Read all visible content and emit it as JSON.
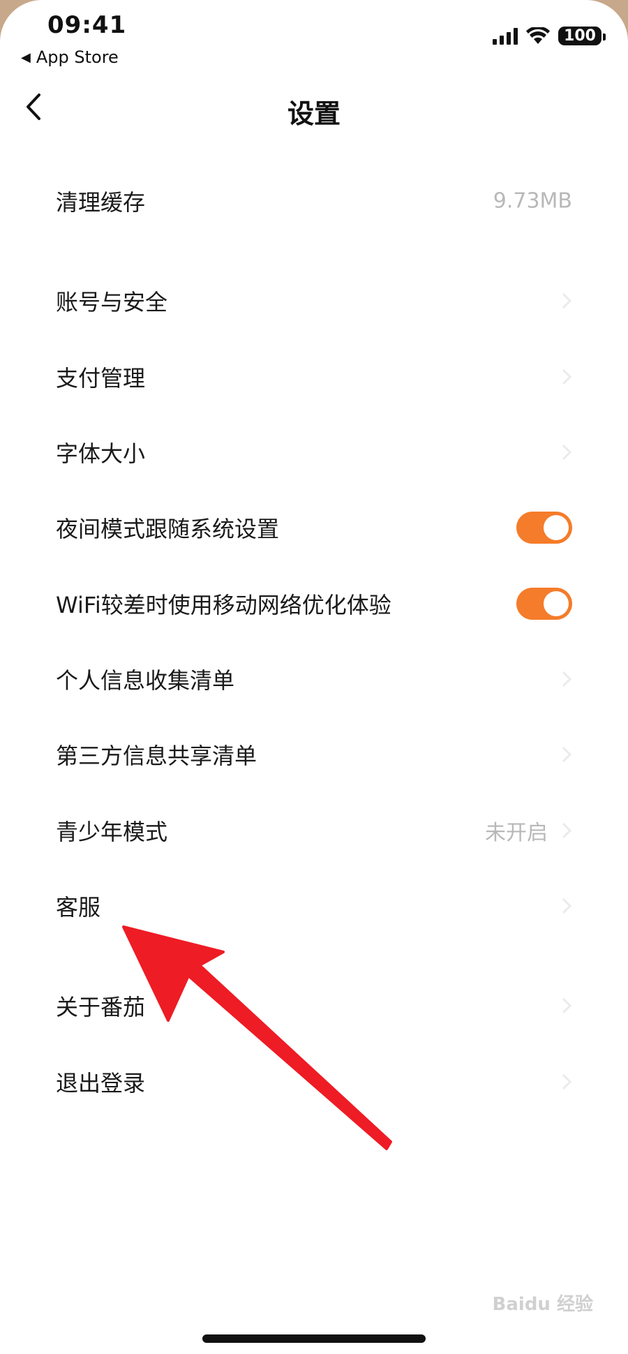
{
  "status_bar": {
    "time": "09:41",
    "back_app": "App Store",
    "battery": "100"
  },
  "nav": {
    "title": "设置"
  },
  "settings": {
    "clear_cache": {
      "label": "清理缓存",
      "value": "9.73MB"
    },
    "account_security": {
      "label": "账号与安全"
    },
    "payment": {
      "label": "支付管理"
    },
    "font_size": {
      "label": "字体大小"
    },
    "night_mode": {
      "label": "夜间模式跟随系统设置",
      "enabled": true
    },
    "wifi_optimize": {
      "label": "WiFi较差时使用移动网络优化体验",
      "enabled": true
    },
    "personal_info": {
      "label": "个人信息收集清单"
    },
    "third_party": {
      "label": "第三方信息共享清单"
    },
    "teen_mode": {
      "label": "青少年模式",
      "value": "未开启"
    },
    "customer_service": {
      "label": "客服"
    },
    "about": {
      "label": "关于番茄"
    },
    "logout": {
      "label": "退出登录"
    }
  },
  "watermark": "Baidu 经验",
  "colors": {
    "toggle_on": "#f57c2a",
    "annotation_arrow": "#ee1c25",
    "secondary_text": "#b8b8b8"
  }
}
